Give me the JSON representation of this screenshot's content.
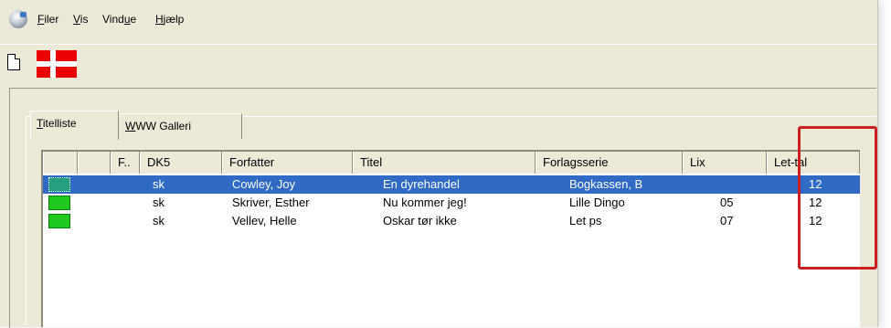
{
  "menu": {
    "items": [
      {
        "first": "F",
        "rest": "iler"
      },
      {
        "first": "V",
        "rest": "is"
      },
      {
        "pre": "Vind",
        "first": "u",
        "rest": "e"
      },
      {
        "first": "H",
        "rest": "jælp"
      }
    ]
  },
  "toolbar": {
    "new_icon": "new-document-icon",
    "flag_icon": "danish-flag-icon",
    "flag_colors": {
      "red": "#ea0000",
      "white": "#ffffff"
    }
  },
  "tabs": [
    {
      "first": "T",
      "rest": "itelliste",
      "active": true
    },
    {
      "first": "W",
      "rest": "WW Galleri",
      "active": false
    }
  ],
  "table": {
    "columns": [
      "",
      "",
      "F..",
      "DK5",
      "Forfatter",
      "Titel",
      "Forlagsserie",
      "Lix",
      "Let-tal"
    ],
    "rows": [
      {
        "dk5": "sk",
        "forfatter": "Cowley, Joy",
        "titel": "En dyrehandel",
        "forlagsserie": "Bogkassen, B",
        "lix": "",
        "let_tal": "12",
        "selected": true
      },
      {
        "dk5": "sk",
        "forfatter": "Skriver, Esther",
        "titel": "Nu kommer jeg!",
        "forlagsserie": "Lille Dingo",
        "lix": "05",
        "let_tal": "12",
        "selected": false
      },
      {
        "dk5": "sk",
        "forfatter": "Vellev, Helle",
        "titel": "Oskar tør ikke",
        "forlagsserie": "Let ps",
        "lix": "07",
        "let_tal": "12",
        "selected": false
      }
    ]
  },
  "colors": {
    "selection": "#316ac5",
    "status_green": "#1ec81e",
    "highlight_red": "#cc2020"
  }
}
